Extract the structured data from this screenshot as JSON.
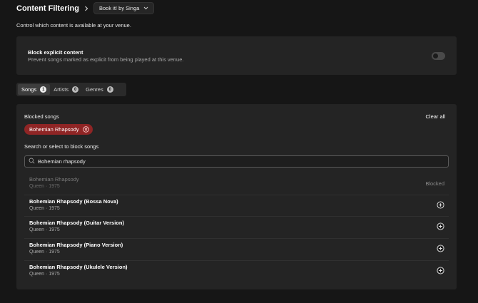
{
  "header": {
    "title": "Content Filtering",
    "venue_select": "Book it! by Singa"
  },
  "subtitle": "Control which content is available at your venue.",
  "explicit": {
    "title": "Block explicit content",
    "description": "Prevent songs marked as explicit from being played at this venue.",
    "enabled": false
  },
  "tabs": [
    {
      "label": "Songs",
      "count": "1",
      "active": true
    },
    {
      "label": "Artists",
      "count": "0",
      "active": false
    },
    {
      "label": "Genres",
      "count": "0",
      "active": false
    }
  ],
  "blocked": {
    "heading": "Blocked songs",
    "clear_all": "Clear all",
    "chips": [
      "Bohemian Rhapsody"
    ]
  },
  "search": {
    "label": "Search or select to block songs",
    "value": "Bohemian rhapsody"
  },
  "results": [
    {
      "title": "Bohemian Rhapsody",
      "meta": "Queen · 1975",
      "status": "Blocked"
    },
    {
      "title": "Bohemian Rhapsody (Bossa Nova)",
      "meta": "Queen · 1975",
      "status": ""
    },
    {
      "title": "Bohemian Rhapsody (Guitar Version)",
      "meta": "Queen · 1975",
      "status": ""
    },
    {
      "title": "Bohemian Rhapsody (Piano Version)",
      "meta": "Queen · 1975",
      "status": ""
    },
    {
      "title": "Bohemian Rhapsody (Ukulele Version)",
      "meta": "Queen · 1975",
      "status": ""
    }
  ],
  "colors": {
    "background": "#161616",
    "card": "#242424",
    "chip": "#8f2525"
  },
  "icons": {
    "breadcrumb": "chevron-right-icon",
    "select": "chevron-down-icon",
    "chip_remove": "close-circle-icon",
    "search": "search-icon",
    "add": "plus-circle-icon"
  }
}
